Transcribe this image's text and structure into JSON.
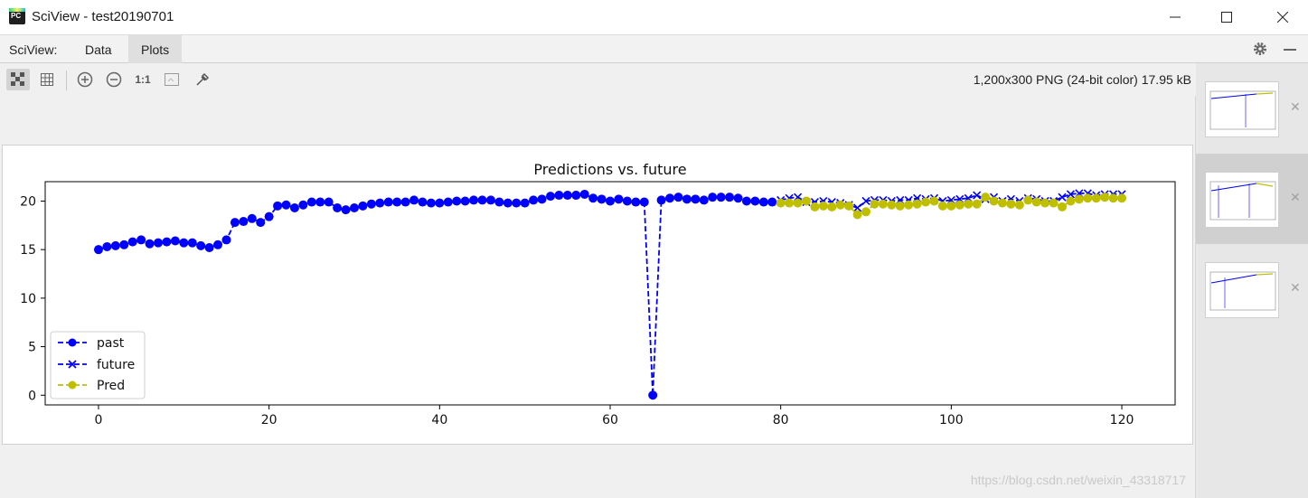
{
  "window": {
    "title": "SciView - test20190701"
  },
  "menubar": {
    "label": "SciView:",
    "tabs": [
      "Data",
      "Plots"
    ],
    "active_tab": "Plots"
  },
  "toolbar": {
    "image_info": "1,200x300 PNG (24-bit color) 17.95 kB",
    "zoom_actual_label": "1:1"
  },
  "watermark": "https://blog.csdn.net/weixin_43318717",
  "chart_data": {
    "type": "line",
    "title": "Predictions vs. future",
    "xlabel": "",
    "ylabel": "",
    "xlim": [
      -6.25,
      126.25
    ],
    "ylim": [
      -1,
      22
    ],
    "xticks": [
      0,
      20,
      40,
      60,
      80,
      100,
      120
    ],
    "yticks": [
      0,
      5,
      10,
      15,
      20
    ],
    "legend_position": "lower-left",
    "series": [
      {
        "name": "past",
        "color": "#0000ff",
        "marker": "circle",
        "x_start": 0,
        "values": [
          15.0,
          15.3,
          15.4,
          15.5,
          15.8,
          16.0,
          15.6,
          15.7,
          15.8,
          15.9,
          15.7,
          15.7,
          15.4,
          15.2,
          15.5,
          16.0,
          17.8,
          17.9,
          18.2,
          17.8,
          18.4,
          19.5,
          19.6,
          19.3,
          19.6,
          19.9,
          19.9,
          19.9,
          19.3,
          19.1,
          19.3,
          19.5,
          19.7,
          19.8,
          19.9,
          19.9,
          19.9,
          20.1,
          19.9,
          19.8,
          19.8,
          19.9,
          20.0,
          20.0,
          20.1,
          20.1,
          20.1,
          19.9,
          19.8,
          19.8,
          19.8,
          20.1,
          20.2,
          20.5,
          20.6,
          20.6,
          20.6,
          20.7,
          20.3,
          20.2,
          20.0,
          20.2,
          20.0,
          19.9,
          19.9,
          0.0,
          20.1,
          20.3,
          20.4,
          20.2,
          20.2,
          20.1,
          20.4,
          20.4,
          20.4,
          20.3,
          20.0,
          20.0,
          19.9,
          19.9
        ]
      },
      {
        "name": "future",
        "color": "#0000ff",
        "marker": "x",
        "x_start": 80,
        "values": [
          20.1,
          20.3,
          20.4,
          19.9,
          19.9,
          20.0,
          19.9,
          19.8,
          19.6,
          19.3,
          20.0,
          20.1,
          20.1,
          20.0,
          20.1,
          20.1,
          20.3,
          20.2,
          20.3,
          20.0,
          20.1,
          20.2,
          20.3,
          20.6,
          20.2,
          20.4,
          20.0,
          20.2,
          20.0,
          20.3,
          20.2,
          20.0,
          20.0,
          20.4,
          20.7,
          20.8,
          20.8,
          20.6,
          20.7,
          20.7,
          20.7
        ]
      },
      {
        "name": "Pred",
        "color": "#bfbf00",
        "marker": "circle",
        "x_start": 80,
        "values": [
          19.8,
          19.8,
          19.8,
          20.0,
          19.4,
          19.5,
          19.4,
          19.6,
          19.5,
          18.6,
          18.9,
          19.7,
          19.7,
          19.6,
          19.5,
          19.6,
          19.7,
          19.9,
          20.0,
          19.5,
          19.5,
          19.6,
          19.7,
          19.7,
          20.4,
          20.0,
          19.8,
          19.7,
          19.6,
          20.1,
          19.9,
          19.8,
          19.8,
          19.4,
          20.0,
          20.2,
          20.3,
          20.3,
          20.4,
          20.3,
          20.3
        ]
      }
    ]
  }
}
